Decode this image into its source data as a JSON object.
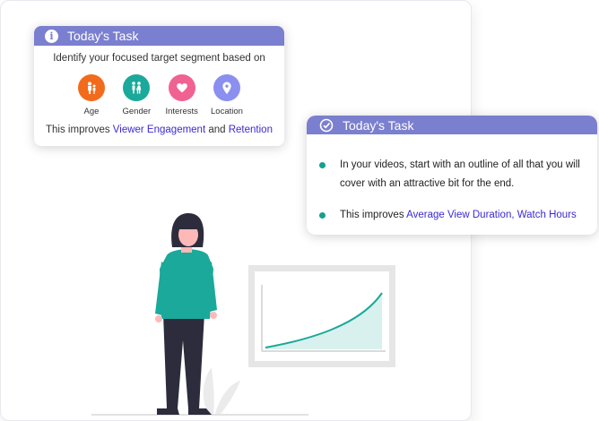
{
  "card1": {
    "header_title": "Today's Task",
    "subtitle": "Identify your focused target segment based on",
    "segments": [
      {
        "label": "Age",
        "icon": "people-icon",
        "color": "#f26b1d"
      },
      {
        "label": "Gender",
        "icon": "gender-icon",
        "color": "#1aa99a"
      },
      {
        "label": "Interests",
        "icon": "heart-icon",
        "color": "#f06292"
      },
      {
        "label": "Location",
        "icon": "location-pin-icon",
        "color": "#8a8ff0"
      }
    ],
    "footer_prefix": "This improves ",
    "footer_link1": "Viewer Engagement",
    "footer_and": " and ",
    "footer_link2": "Retention"
  },
  "card2": {
    "header_title": "Today's Task",
    "item1": "In your videos, start with an outline of all that you will cover with an attractive bit for the end.",
    "item2_prefix": "This improves ",
    "item2_link": "Average View Duration, Watch Hours"
  },
  "colors": {
    "header": "#7b7fcf",
    "accent_teal": "#14a08d",
    "link": "#3a2ad6"
  }
}
